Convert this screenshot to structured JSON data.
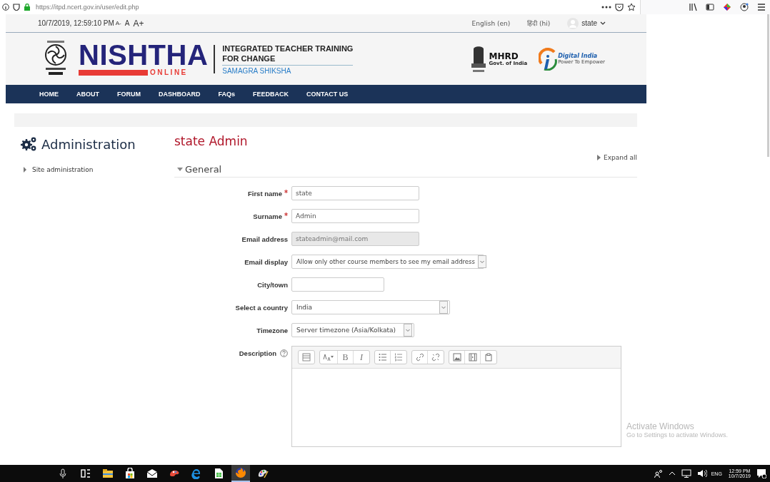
{
  "browser": {
    "url": "https://itpd.ncert.gov.in/user/edit.php"
  },
  "topbar": {
    "datetime": "10/7/2019, 12:59:10 PM",
    "font_sizes": [
      "A-",
      "A",
      "A+"
    ],
    "languages": [
      "English (en)",
      "हिंदी (hi)"
    ],
    "user": "state"
  },
  "header": {
    "brand": "NISHTHA",
    "brand_sub": "ONLINE",
    "tagline": [
      "INTEGRATED TEACHER TRAINING",
      "FOR CHANGE"
    ],
    "program": "SAMAGRA SHIKSHA",
    "emblem_text": "MHRD",
    "emblem_sub": "Govt. of India",
    "digital": "Digital India",
    "digital_sub": "Power To Empower"
  },
  "nav": [
    "HOME",
    "ABOUT",
    "FORUM",
    "DASHBOARD",
    "FAQs",
    "FEEDBACK",
    "CONTACT US"
  ],
  "sidebar": {
    "title": "Administration",
    "items": [
      {
        "label": "Site administration",
        "expanded": false
      }
    ]
  },
  "page": {
    "title": "state Admin",
    "expand_all": "Expand all",
    "section": {
      "label": "General",
      "expanded": true
    }
  },
  "fields": [
    {
      "kind": "text",
      "label": "First name",
      "required": true,
      "value": "state"
    },
    {
      "kind": "text",
      "label": "Surname",
      "required": true,
      "value": "Admin"
    },
    {
      "kind": "text",
      "label": "Email address",
      "disabled": true,
      "value": "stateadmin@mail.com"
    },
    {
      "kind": "select",
      "label": "Email display",
      "value": "Allow only other course members to see my email address"
    },
    {
      "kind": "text",
      "label": "City/town"
    },
    {
      "kind": "select",
      "label": "Select a country",
      "value": "India"
    },
    {
      "kind": "select",
      "label": "Timezone",
      "value": "Server timezone (Asia/Kolkata)"
    },
    {
      "kind": "editor",
      "label": "Description",
      "bold": "B",
      "italic": "I"
    }
  ],
  "overlay": {
    "title": "Activate Windows",
    "text": "Go to Settings to activate Windows."
  },
  "taskbar": {
    "apps": [
      {
        "selected": false
      },
      {
        "selected": false
      },
      {
        "selected": false
      },
      {
        "selected": false
      },
      {
        "selected": false
      },
      {
        "selected": false
      },
      {
        "selected": false
      },
      {
        "selected": true
      },
      {
        "selected": false
      }
    ],
    "language": "ENG",
    "time": "12:59 PM",
    "date": "10/7/2019"
  }
}
